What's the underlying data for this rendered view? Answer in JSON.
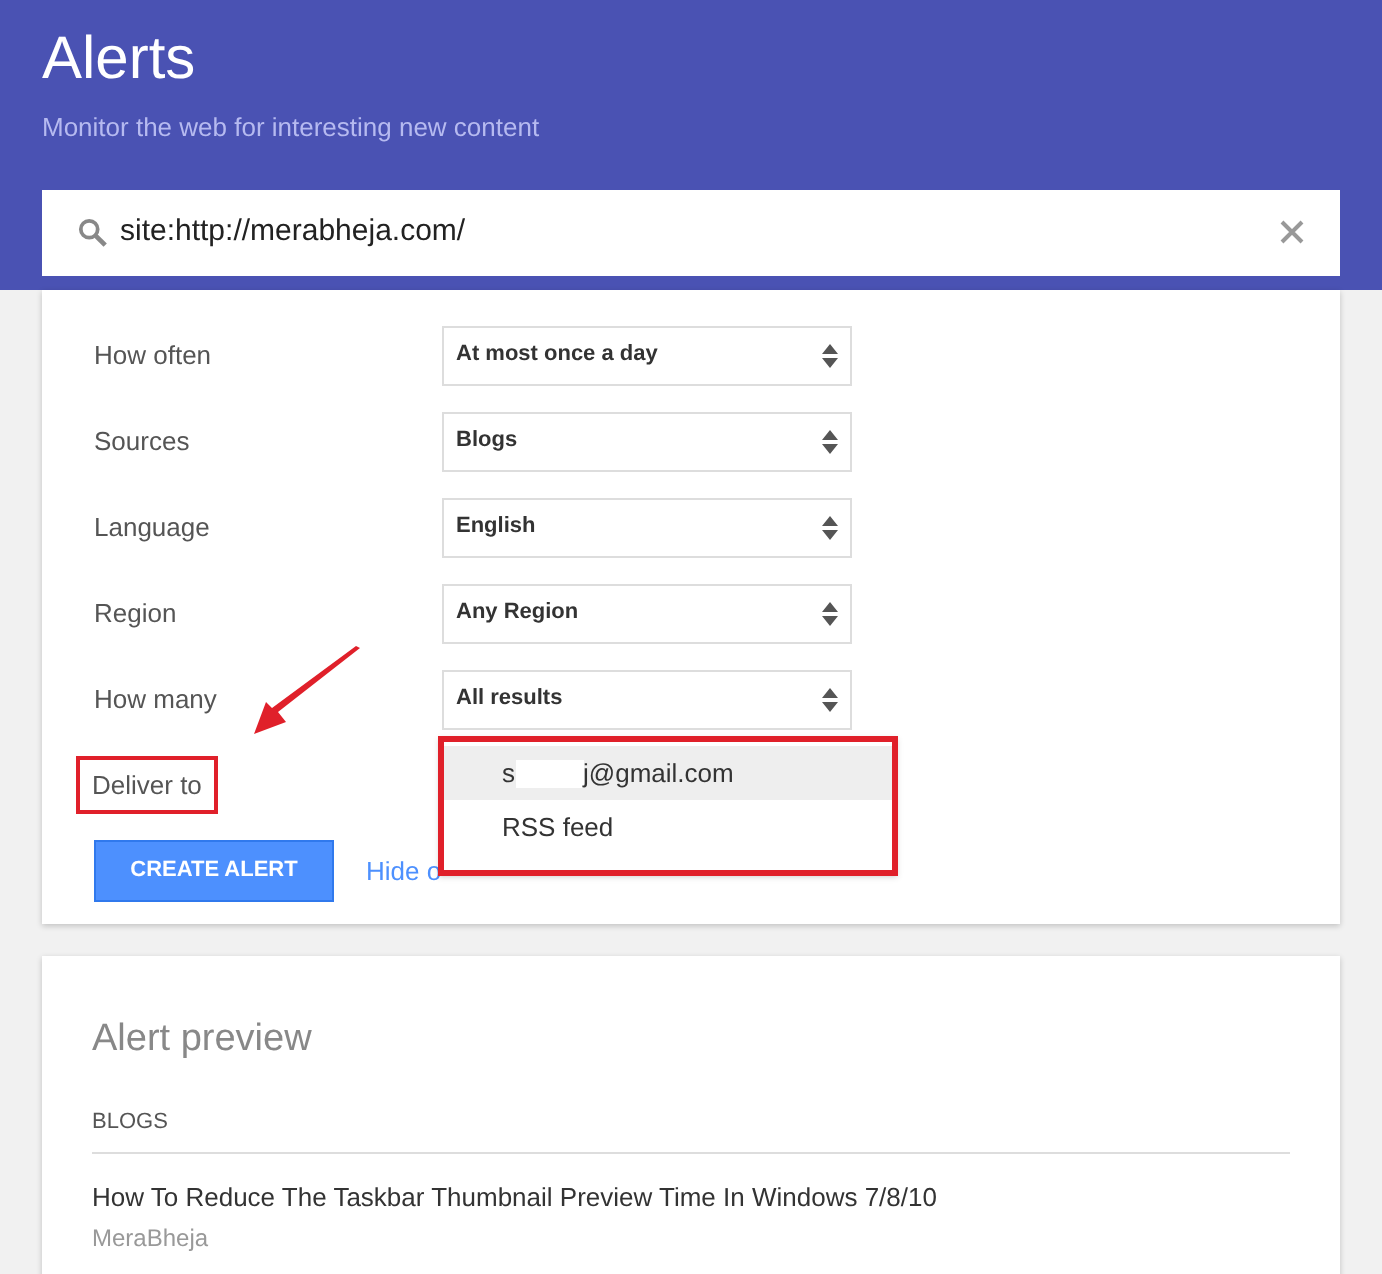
{
  "header": {
    "title": "Alerts",
    "subtitle": "Monitor the web for interesting new content"
  },
  "search": {
    "value": "site:http://merabheja.com/"
  },
  "settings": [
    {
      "label": "How often",
      "value": "At most once a day"
    },
    {
      "label": "Sources",
      "value": "Blogs"
    },
    {
      "label": "Language",
      "value": "English"
    },
    {
      "label": "Region",
      "value": "Any Region"
    },
    {
      "label": "How many",
      "value": "All results"
    }
  ],
  "deliver": {
    "label": "Deliver to",
    "options": [
      {
        "kind": "redacted",
        "start": "s",
        "end": "j@gmail.com",
        "selected": true
      },
      {
        "kind": "plain",
        "text": "RSS feed",
        "selected": false
      }
    ]
  },
  "create_button": "CREATE ALERT",
  "hide_link": "Hide o",
  "preview": {
    "title": "Alert preview",
    "section": "BLOGS",
    "items": [
      {
        "title": "How To Reduce The Taskbar Thumbnail Preview Time In Windows 7/8/10",
        "source": "MeraBheja"
      }
    ]
  }
}
